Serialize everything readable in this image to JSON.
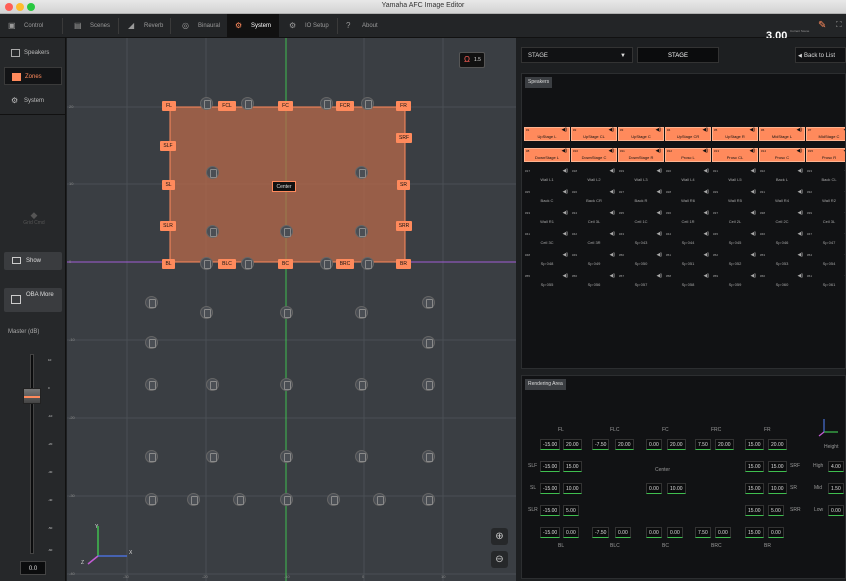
{
  "window": {
    "title": "Yamaha AFC Image Editor"
  },
  "tabs": [
    {
      "label": "Control",
      "icon": "control-icon"
    },
    {
      "label": "Scenes",
      "icon": "scenes-icon"
    },
    {
      "label": "Reverb",
      "icon": "reverb-icon"
    },
    {
      "label": "Binaural",
      "icon": "binaural-icon"
    },
    {
      "label": "System",
      "icon": "system-icon"
    },
    {
      "label": "IO Setup",
      "icon": "io-setup-icon"
    },
    {
      "label": "About",
      "icon": "about-icon"
    }
  ],
  "preset": {
    "number": "3.00",
    "caption": "Current Scene"
  },
  "sidebar": {
    "items": [
      {
        "label": "Speakers"
      },
      {
        "label": "Zones"
      },
      {
        "label": "System"
      }
    ],
    "grid_label": "Grid Cmd",
    "show_label": "Show",
    "oba_label": "OBA More",
    "master_label": "Master (dB)",
    "master_value": "0.0",
    "fader_ticks": [
      "10",
      "0",
      "-10",
      "-20",
      "-30",
      "-40",
      "-50",
      "-60"
    ]
  },
  "canvas": {
    "zone_badge": "1.5",
    "center_label": "Center",
    "tags": [
      "FL",
      "FCL",
      "FC",
      "FCR",
      "FR",
      "SLF",
      "SRF",
      "SL",
      "SR",
      "SLR",
      "SRR",
      "BL",
      "BLC",
      "BC",
      "BRC",
      "BR"
    ],
    "ruler_left": [
      "20",
      "10",
      "0",
      "-10",
      "-20",
      "-30",
      "-40"
    ],
    "ruler_bottom": [
      "-30",
      "-20",
      "-10",
      "0",
      "10",
      "20"
    ],
    "axis_y": "Y",
    "axis_x": "X",
    "axis_z": "Z"
  },
  "right": {
    "stage_select": "STAGE",
    "stage_title": "STAGE",
    "back_label": "Back to List",
    "speakers_header": "Speakers",
    "active_speakers": [
      {
        "id": "#1",
        "name": "UpStage L"
      },
      {
        "id": "#2",
        "name": "UpStage CL"
      },
      {
        "id": "#3",
        "name": "UpStage C"
      },
      {
        "id": "#4",
        "name": "UpStage CR"
      },
      {
        "id": "#5",
        "name": "UpStage R"
      },
      {
        "id": "#6",
        "name": "MidStage L"
      },
      {
        "id": "#7",
        "name": "MidStage C"
      },
      {
        "id": "#8",
        "name": "DownStage L"
      },
      {
        "id": "#10",
        "name": "DownStage C"
      },
      {
        "id": "#11",
        "name": "DownStage R"
      },
      {
        "id": "#12",
        "name": "Prosc L"
      },
      {
        "id": "#13",
        "name": "Prosc CL"
      },
      {
        "id": "#14",
        "name": "Prosc C"
      },
      {
        "id": "#15",
        "name": "Prosc R"
      }
    ],
    "inactive_speakers": [
      {
        "id": "#17",
        "name": "Wall L1"
      },
      {
        "id": "#18",
        "name": "Wall L2"
      },
      {
        "id": "#19",
        "name": "Wall L3"
      },
      {
        "id": "#20",
        "name": "Wall L4"
      },
      {
        "id": "#21",
        "name": "Wall L5"
      },
      {
        "id": "#22",
        "name": "Back L"
      },
      {
        "id": "#23",
        "name": "Back CL"
      },
      {
        "id": "#25",
        "name": "Back C"
      },
      {
        "id": "#26",
        "name": "Back CR"
      },
      {
        "id": "#27",
        "name": "Back R"
      },
      {
        "id": "#28",
        "name": "Wall R6"
      },
      {
        "id": "#29",
        "name": "Wall R5"
      },
      {
        "id": "#31",
        "name": "Wall R4"
      },
      {
        "id": "#32",
        "name": "Wall R2"
      },
      {
        "id": "#33",
        "name": "Wall R1"
      },
      {
        "id": "#34",
        "name": "Ceil 3L"
      },
      {
        "id": "#35",
        "name": "Ceil 1C"
      },
      {
        "id": "#36",
        "name": "Ceil 1R"
      },
      {
        "id": "#37",
        "name": "Ceil 2L"
      },
      {
        "id": "#38",
        "name": "Ceil 2C"
      },
      {
        "id": "#39",
        "name": "Ceil 3L"
      },
      {
        "id": "#41",
        "name": "Ceil 3C"
      },
      {
        "id": "#42",
        "name": "Ceil 3R"
      },
      {
        "id": "#43",
        "name": "Sp 043"
      },
      {
        "id": "#44",
        "name": "Sp 044"
      },
      {
        "id": "#45",
        "name": "Sp 045"
      },
      {
        "id": "#46",
        "name": "Sp 046"
      },
      {
        "id": "#47",
        "name": "Sp 047"
      },
      {
        "id": "#48",
        "name": "Sp 048"
      },
      {
        "id": "#49",
        "name": "Sp 049"
      },
      {
        "id": "#50",
        "name": "Sp 050"
      },
      {
        "id": "#51",
        "name": "Sp 051"
      },
      {
        "id": "#52",
        "name": "Sp 052"
      },
      {
        "id": "#53",
        "name": "Sp 053"
      },
      {
        "id": "#54",
        "name": "Sp 054"
      },
      {
        "id": "#55",
        "name": "Sp 055"
      },
      {
        "id": "#56",
        "name": "Sp 056"
      },
      {
        "id": "#57",
        "name": "Sp 057"
      },
      {
        "id": "#58",
        "name": "Sp 058"
      },
      {
        "id": "#59",
        "name": "Sp 059"
      },
      {
        "id": "#60",
        "name": "Sp 060"
      },
      {
        "id": "#61",
        "name": "Sp 061"
      }
    ],
    "rendering_header": "Rendering Area",
    "render_top_labels": [
      "FL",
      "FLC",
      "FC",
      "FRC",
      "FR"
    ],
    "render_top_values": [
      [
        "-15.00",
        "20.00"
      ],
      [
        "-7.50",
        "20.00"
      ],
      [
        "0.00",
        "20.00"
      ],
      [
        "7.50",
        "20.00"
      ],
      [
        "15.00",
        "20.00"
      ]
    ],
    "render_side_left": [
      {
        "label": "SLF",
        "values": [
          "-15.00",
          "15.00"
        ]
      },
      {
        "label": "SL",
        "values": [
          "-15.00",
          "10.00"
        ]
      },
      {
        "label": "SLR",
        "values": [
          "-15.00",
          "5.00"
        ]
      }
    ],
    "render_side_right": [
      {
        "label": "SRF",
        "values": [
          "15.00",
          "15.00"
        ]
      },
      {
        "label": "SR",
        "values": [
          "15.00",
          "10.00"
        ]
      },
      {
        "label": "SRR",
        "values": [
          "15.00",
          "5.00"
        ]
      }
    ],
    "render_center_label": "Center",
    "render_center_values": [
      "0.00",
      "10.00"
    ],
    "render_bottom_labels": [
      "BL",
      "BLC",
      "BC",
      "BRC",
      "BR"
    ],
    "render_bottom_values": [
      [
        "-15.00",
        "0.00"
      ],
      [
        "-7.50",
        "0.00"
      ],
      [
        "0.00",
        "0.00"
      ],
      [
        "7.50",
        "0.00"
      ],
      [
        "15.00",
        "0.00"
      ]
    ],
    "height_label": "Height",
    "height_rows": [
      {
        "label": "High",
        "value": "4.00"
      },
      {
        "label": "Mid",
        "value": "1.50"
      },
      {
        "label": "Low",
        "value": "0.00"
      }
    ]
  }
}
